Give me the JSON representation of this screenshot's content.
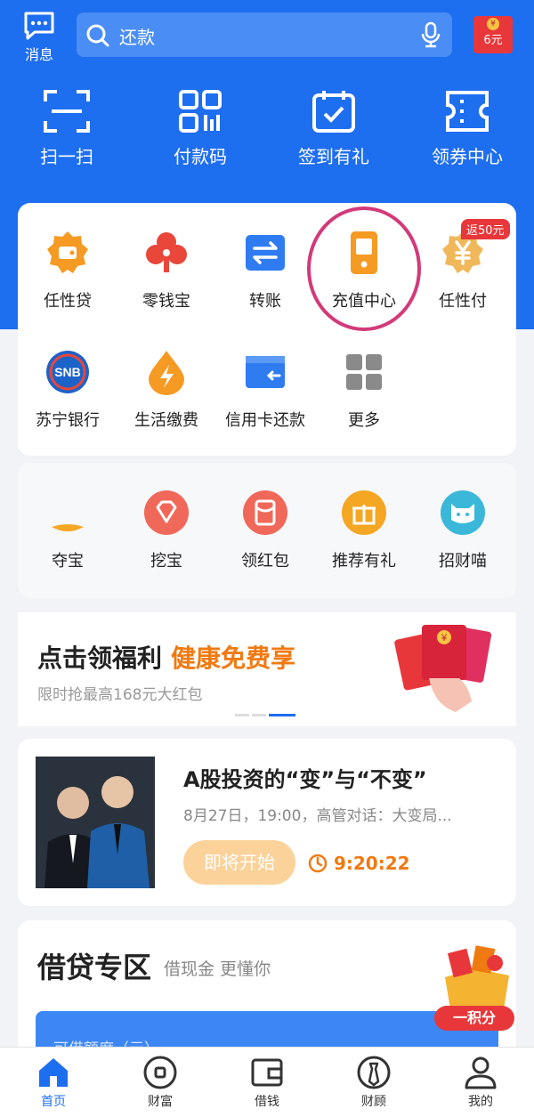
{
  "header": {
    "message_label": "消息",
    "search_placeholder": "还款",
    "redpack_amount": "6元",
    "redpack_coin": "¥"
  },
  "quick_actions": [
    {
      "label": "扫一扫",
      "icon": "scan-icon"
    },
    {
      "label": "付款码",
      "icon": "qrcode-icon"
    },
    {
      "label": "签到有礼",
      "icon": "calendar-check-icon"
    },
    {
      "label": "领券中心",
      "icon": "coupon-icon"
    }
  ],
  "services_row1": [
    {
      "label": "任性贷",
      "icon": "wallet-badge-icon",
      "color": "#f59a23"
    },
    {
      "label": "零钱宝",
      "icon": "clover-icon",
      "color": "#e8473a"
    },
    {
      "label": "转账",
      "icon": "transfer-icon",
      "color": "#2f7bf0"
    },
    {
      "label": "充值中心",
      "icon": "phone-recharge-icon",
      "color": "#f59a23"
    },
    {
      "label": "任性付",
      "icon": "yen-badge-icon",
      "color": "#f0a93a"
    }
  ],
  "badge": "返50元",
  "services_row2": [
    {
      "label": "苏宁银行",
      "icon": "snb-bank-icon",
      "mark": "SNB"
    },
    {
      "label": "生活缴费",
      "icon": "lightning-drop-icon"
    },
    {
      "label": "信用卡还款",
      "icon": "credit-card-icon"
    },
    {
      "label": "更多",
      "icon": "more-grid-icon"
    }
  ],
  "services_row3": [
    {
      "label": "夺宝",
      "icon": "treasure-icon"
    },
    {
      "label": "挖宝",
      "icon": "diamond-icon"
    },
    {
      "label": "领红包",
      "icon": "red-envelope-icon"
    },
    {
      "label": "推荐有礼",
      "icon": "gift-icon"
    },
    {
      "label": "招财喵",
      "icon": "cat-icon"
    }
  ],
  "banner": {
    "title": "点击领福利",
    "highlight": "健康免费享",
    "subtitle": "限时抢最高168元大红包",
    "envelope_mark": "¥"
  },
  "live": {
    "title": "A股投资的“变”与“不变”",
    "desc": "8月27日，19:00，高管对话：大变局...",
    "button": "即将开始",
    "timer": "9:20:22"
  },
  "loan": {
    "title": "借贷专区",
    "subtitle": "借现金 更懂你",
    "bar_text": "可借额度（元）",
    "promo": "一积分"
  },
  "tabs": [
    {
      "label": "首页",
      "icon": "home-icon",
      "active": true
    },
    {
      "label": "财富",
      "icon": "wealth-icon"
    },
    {
      "label": "借钱",
      "icon": "wallet-icon"
    },
    {
      "label": "财顾",
      "icon": "advisor-icon"
    },
    {
      "label": "我的",
      "icon": "user-icon"
    }
  ],
  "colors": {
    "primary": "#1e6ef0",
    "accent": "#f07a12",
    "highlight_ring": "#d23a7a",
    "badge_red": "#e8373a"
  }
}
